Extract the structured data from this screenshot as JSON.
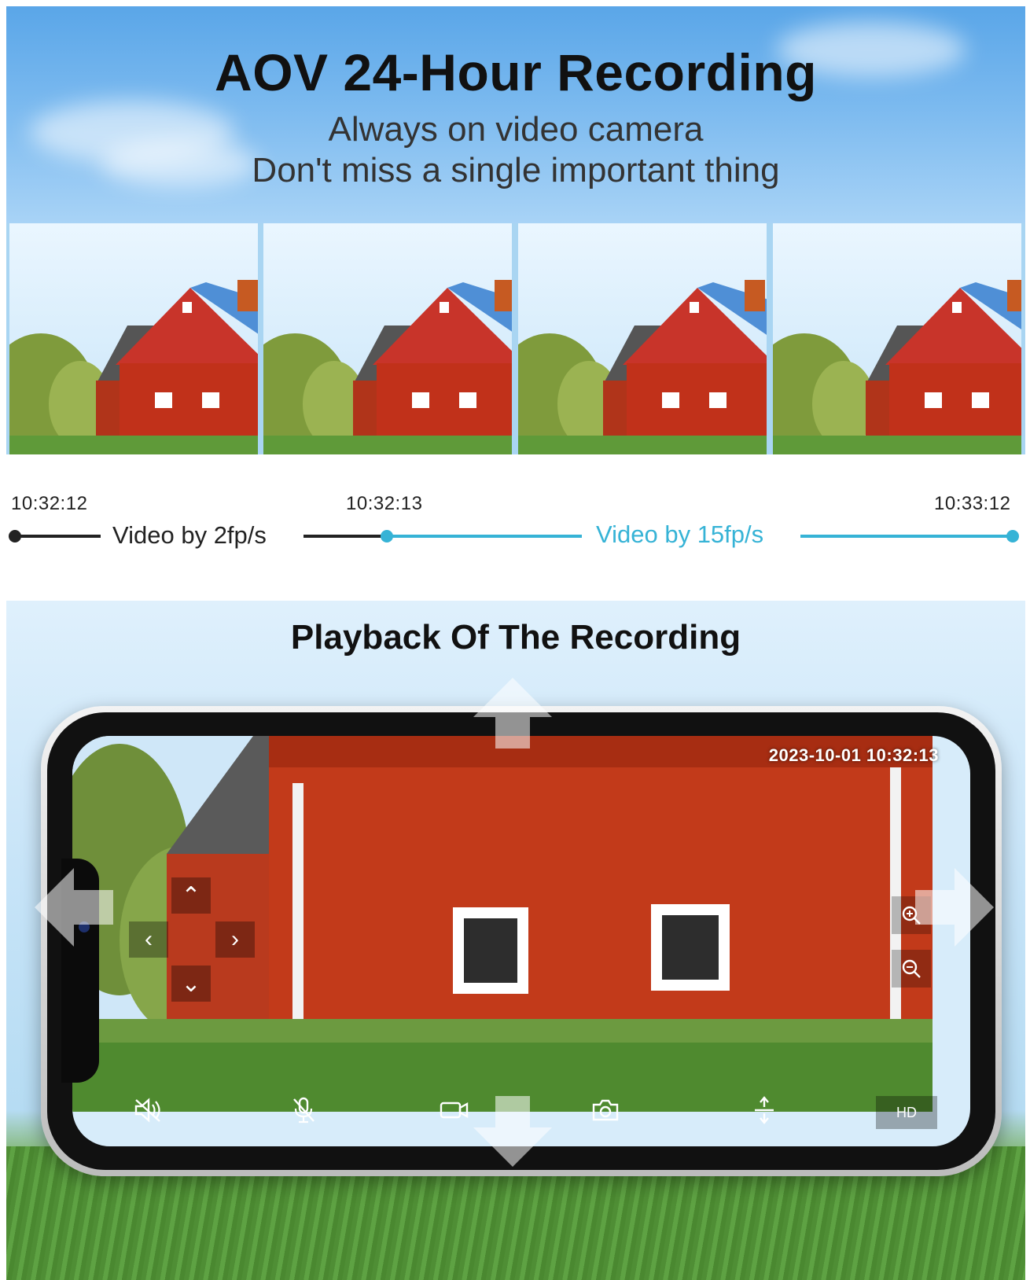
{
  "banner": {
    "title": "AOV 24-Hour Recording",
    "subtitle_line1": "Always on video camera",
    "subtitle_line2": "Don't miss a single important thing"
  },
  "frames": [
    "barn-frame-1",
    "barn-frame-2",
    "barn-frame-3",
    "barn-frame-4"
  ],
  "timeline": {
    "start_time": "10:32:12",
    "mid_time": "10:32:13",
    "end_time": "10:33:12",
    "low_rate_label": "Video by 2fp/s",
    "high_rate_label": "Video by 15fp/s",
    "colors": {
      "low": "#222222",
      "high": "#36b3d6"
    }
  },
  "playback": {
    "title": "Playback Of The Recording",
    "timestamp": "2023-10-01 10:32:13",
    "quality": "HD",
    "controls": [
      "mute-speaker-icon",
      "mute-mic-icon",
      "record-video-icon",
      "snapshot-camera-icon",
      "flip-icon"
    ],
    "ptz": {
      "up": "⌃",
      "down": "⌄",
      "left": "‹",
      "right": "›"
    }
  }
}
